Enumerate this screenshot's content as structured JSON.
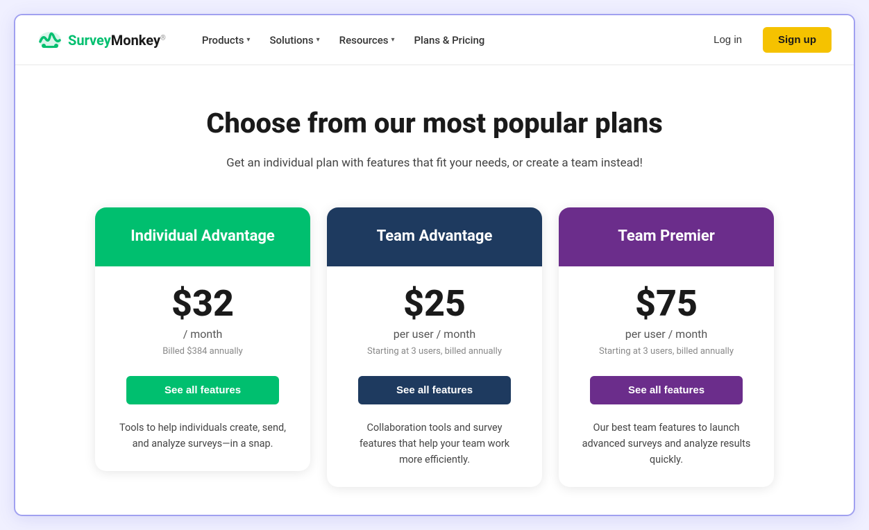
{
  "nav": {
    "logo_text": "SurveyMonkey",
    "items": [
      {
        "label": "Products",
        "has_chevron": true
      },
      {
        "label": "Solutions",
        "has_chevron": true
      },
      {
        "label": "Resources",
        "has_chevron": true
      },
      {
        "label": "Plans & Pricing",
        "has_chevron": false
      }
    ],
    "login_label": "Log in",
    "signup_label": "Sign up"
  },
  "hero": {
    "heading": "Choose from our most popular plans",
    "subheading": "Get an individual plan with features that fit your needs, or create a team instead!"
  },
  "plans": [
    {
      "id": "individual-advantage",
      "title": "Individual Advantage",
      "color": "green",
      "price": "$32",
      "period": "/ month",
      "note": "Billed $384 annually",
      "cta": "See all features",
      "description": "Tools to help individuals create, send, and analyze surveys—in a snap."
    },
    {
      "id": "team-advantage",
      "title": "Team Advantage",
      "color": "navy",
      "price": "$25",
      "period": "per user / month",
      "note": "Starting at 3 users, billed annually",
      "cta": "See all features",
      "description": "Collaboration tools and survey features that help your team work more efficiently."
    },
    {
      "id": "team-premier",
      "title": "Team Premier",
      "color": "purple",
      "price": "$75",
      "period": "per user / month",
      "note": "Starting at 3 users, billed annually",
      "cta": "See all features",
      "description": "Our best team features to launch advanced surveys and analyze results quickly."
    }
  ]
}
